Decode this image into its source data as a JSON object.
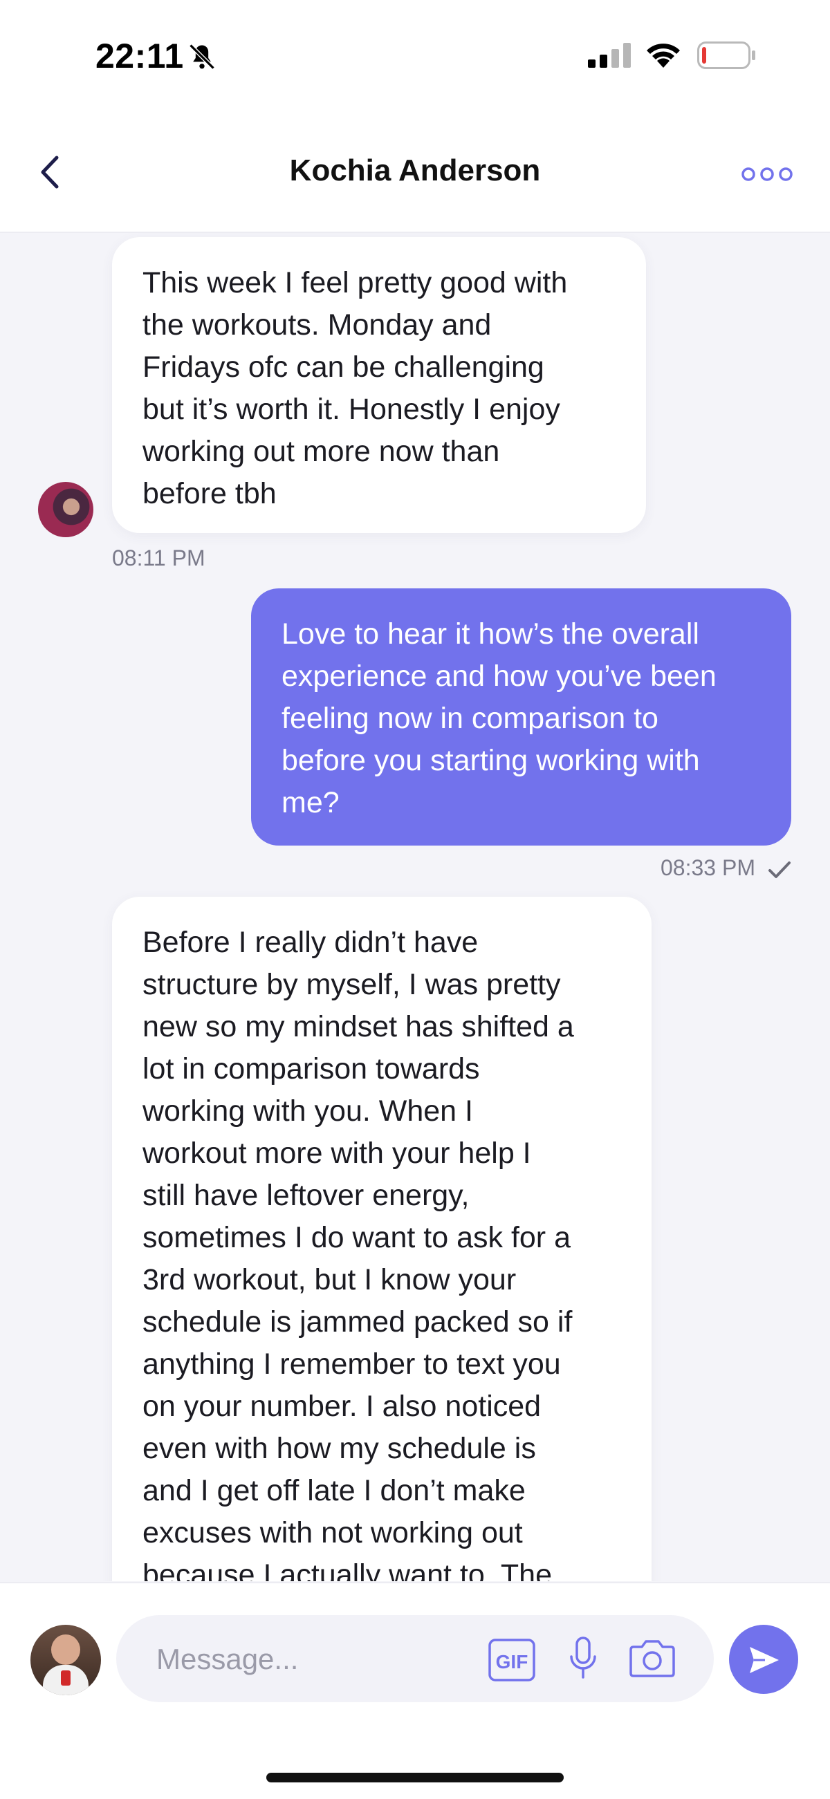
{
  "status": {
    "time": "22:11"
  },
  "header": {
    "title": "Kochia Anderson"
  },
  "messages": [
    {
      "direction": "incoming",
      "text": "This week I feel pretty good with\nthe workouts. Monday and\nFridays ofc can be challenging\nbut it’s worth it. Honestly I enjoy\nworking out more now than\nbefore tbh",
      "time": "08:11 PM"
    },
    {
      "direction": "outgoing",
      "text": "Love to hear it how’s the overall\nexperience and how you’ve been\nfeeling now in comparison to\nbefore you starting working with\nme?",
      "time": "08:33 PM"
    },
    {
      "direction": "incoming",
      "text": "Before I really didn’t have\nstructure by myself, I was pretty\nnew so my mindset has shifted a\nlot in comparison towards\nworking with you. When I\nworkout more with your help I\nstill have leftover energy,\nsometimes I do want to ask for a\n3rd workout, but I know your\nschedule is jammed packed so if\nanything I remember to text you\non your number. I also noticed\neven with how my schedule is\nand I get off late I don’t make\nexcuses with not working out\nbecause I actually want to. The"
    }
  ],
  "composer": {
    "placeholder": "Message...",
    "gif_label": "GIF"
  },
  "icons": {
    "back": "chevron-left-icon",
    "more": "more-horizontal-icon",
    "gif": "gif-icon",
    "mic": "microphone-icon",
    "camera": "camera-icon",
    "send": "send-icon",
    "read": "check-icon"
  },
  "colors": {
    "accent": "#7272ec",
    "background": "#f4f4f9",
    "incoming_bubble": "#ffffff",
    "battery_low": "#e53935"
  }
}
